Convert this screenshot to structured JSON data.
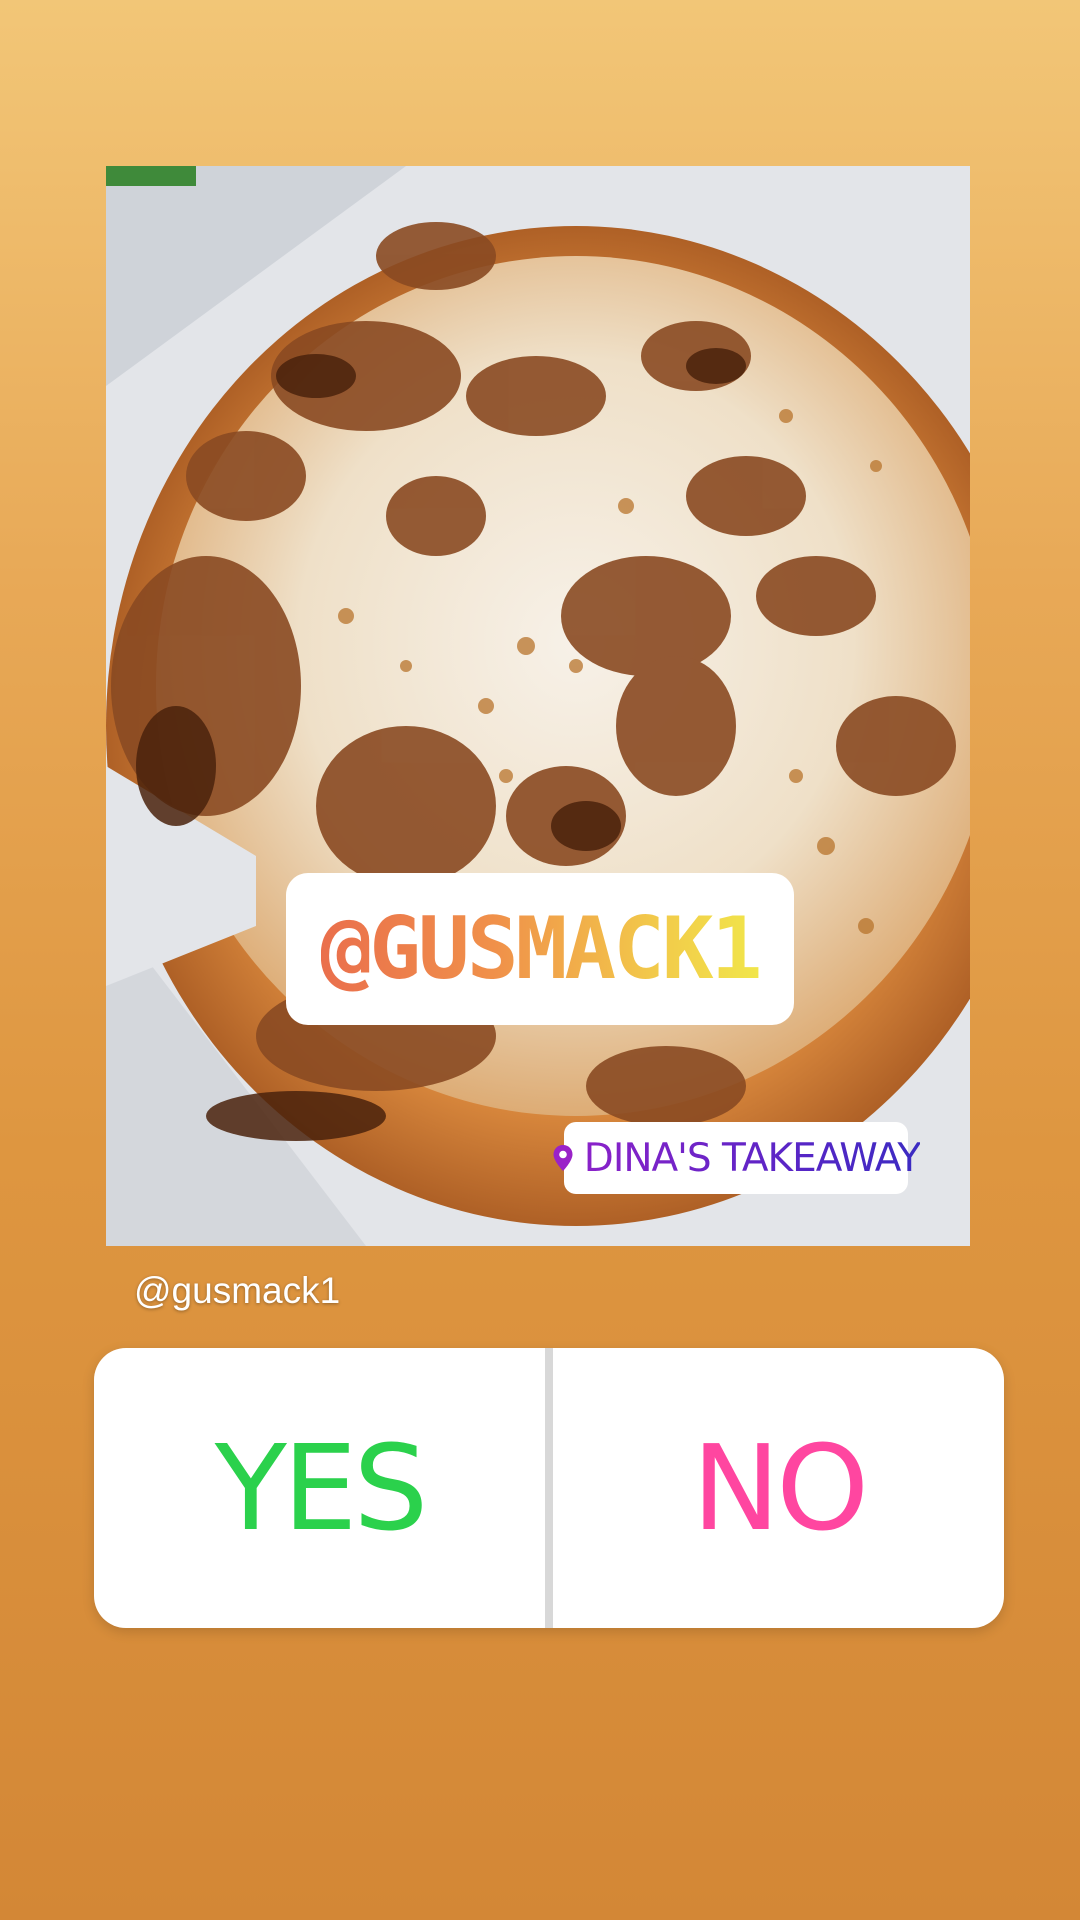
{
  "story": {
    "background_top": "#f2c677",
    "background_bottom": "#d38736"
  },
  "mention_sticker": {
    "text": "@GUSMACK1"
  },
  "location_sticker": {
    "icon": "location-pin-icon",
    "text": "DINA'S TAKEAWAY",
    "color": "#7a24c8"
  },
  "author": {
    "handle": "@gusmack1"
  },
  "poll": {
    "options": [
      {
        "label": "YES",
        "color": "#2bd14c"
      },
      {
        "label": "NO",
        "color": "#ff46a0"
      }
    ]
  }
}
